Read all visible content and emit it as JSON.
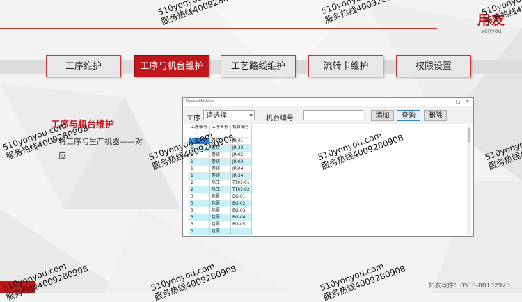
{
  "logo": {
    "cn": "用友",
    "en": "yonyou"
  },
  "tabs": [
    {
      "label": "工序维护",
      "active": false
    },
    {
      "label": "工序与机台维护",
      "active": true
    },
    {
      "label": "工艺路线维护",
      "active": false
    },
    {
      "label": "流转卡维护",
      "active": false
    },
    {
      "label": "权限设置",
      "active": false
    }
  ],
  "section": {
    "title": "工序与机台维护",
    "bullet_mark": "•",
    "bullet": "将工序与生产机器——对应"
  },
  "window": {
    "title": "ProcessMachine",
    "controls": {
      "minimize": "—",
      "maximize": "□",
      "close": "✕"
    },
    "toolbar": {
      "process_label": "工序",
      "process_select": "请选择",
      "machine_label": "机台编号",
      "machine_input": "",
      "add_label": "添加",
      "query_label": "查询",
      "delete_label": "删除"
    },
    "table": {
      "headers": [
        "工序编号",
        "工序名称",
        "机台编号"
      ],
      "rows": [
        [
          "1",
          "卷绕",
          "JR-01"
        ],
        [
          "1",
          "卷绕",
          "JR-33"
        ],
        [
          "1",
          "卷绕",
          "JR-02"
        ],
        [
          "1",
          "卷绕",
          "JR-03"
        ],
        [
          "1",
          "卷绕",
          "JR-04"
        ],
        [
          "1",
          "卷绕",
          "JR-34"
        ],
        [
          "2",
          "热压",
          "TT01-01"
        ],
        [
          "2",
          "热压",
          "TT01-02"
        ],
        [
          "3",
          "包裹",
          "BG-01"
        ],
        [
          "3",
          "包裹",
          "BG-02"
        ],
        [
          "3",
          "包裹",
          "BG-03"
        ],
        [
          "3",
          "包裹",
          "BG-04"
        ],
        [
          "3",
          "包裹",
          "BG-05"
        ],
        [
          "3",
          "包裹",
          ""
        ]
      ]
    }
  },
  "footer": "拓友软件：0510-88102928",
  "watermark": {
    "line1": "510yonyou.com",
    "line2": "服务热线4009280908"
  },
  "colors": {
    "accent": "#c0171d",
    "row_highlight": "#c6f1f6",
    "selection": "#2a79d6"
  }
}
